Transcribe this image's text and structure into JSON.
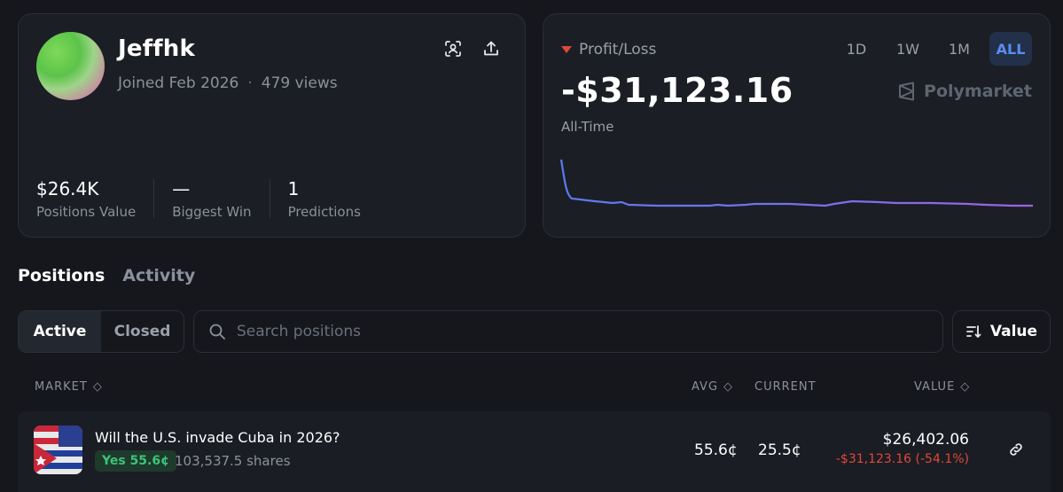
{
  "profile": {
    "username": "Jeffhk",
    "joined": "Joined Feb 2026",
    "views": "479 views",
    "stats": [
      {
        "value": "$26.4K",
        "label": "Positions Value"
      },
      {
        "value": "—",
        "label": "Biggest Win"
      },
      {
        "value": "1",
        "label": "Predictions"
      }
    ]
  },
  "pnl": {
    "label": "Profit/Loss",
    "value": "-$31,123.16",
    "period": "All-Time",
    "ranges": [
      "1D",
      "1W",
      "1M",
      "ALL"
    ],
    "active_range": "ALL",
    "brand": "Polymarket",
    "accent": "#5b8def",
    "loss_color": "#e0473b"
  },
  "tabs": {
    "positions": "Positions",
    "activity": "Activity"
  },
  "filters": {
    "active": "Active",
    "closed": "Closed",
    "search_placeholder": "Search positions",
    "sort_label": "Value"
  },
  "table": {
    "headers": {
      "market": "MARKET",
      "avg": "AVG",
      "current": "CURRENT",
      "value": "VALUE"
    },
    "rows": [
      {
        "title": "Will the U.S. invade Cuba in 2026?",
        "outcome": "Yes 55.6¢",
        "shares": "103,537.5 shares",
        "avg": "55.6¢",
        "current": "25.5¢",
        "value": "$26,402.06",
        "pnl": "-$31,123.16 (-54.1%)"
      }
    ]
  }
}
